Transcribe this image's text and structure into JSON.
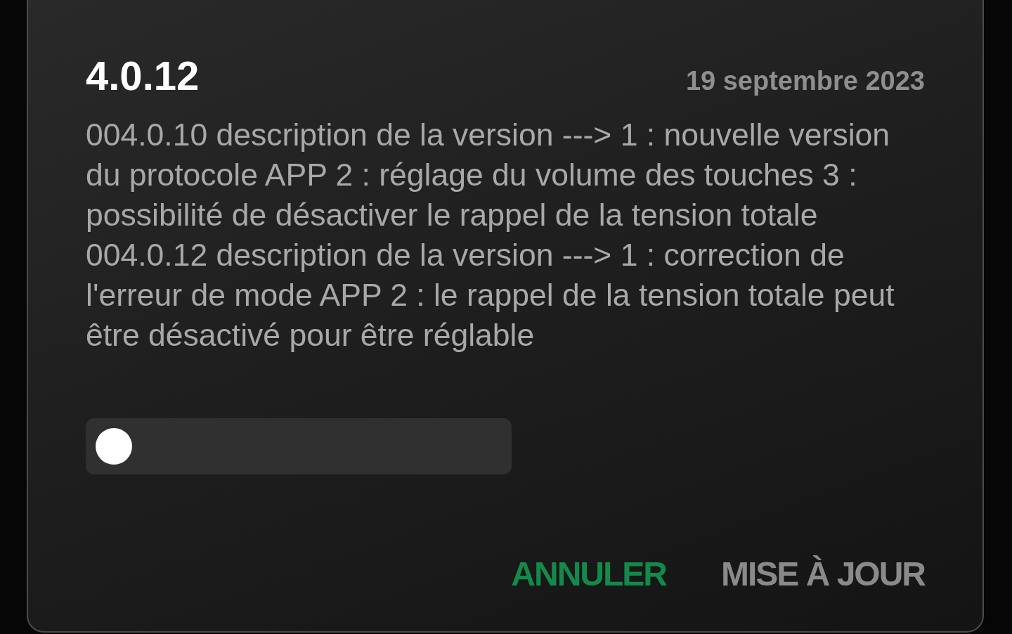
{
  "dialog": {
    "title": "4.0.12",
    "date": "19 septembre 2023",
    "notes": [
      "004.0.10 description de la version ---> 1 : nouvelle version du protocole APP 2 : réglage du volume des touches 3 : possibilité de désactiver le rappel de la tension totale",
      "004.0.12 description de la version ---> 1 : correction de l'erreur de mode APP 2 : le rappel de la tension totale peut être désactivé pour être réglable"
    ],
    "buttons": [
      {
        "label": "ANNULER",
        "kind": "accent"
      },
      {
        "label": "MISE À JOUR",
        "kind": "plain"
      }
    ]
  }
}
